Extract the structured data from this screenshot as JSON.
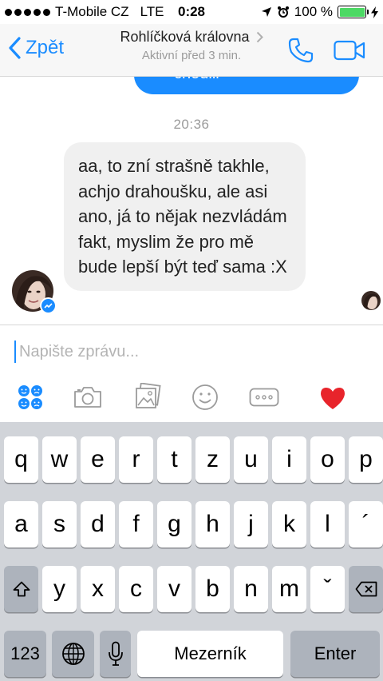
{
  "status_bar": {
    "carrier": "T-Mobile CZ",
    "network": "LTE",
    "time": "0:28",
    "battery": "100 %"
  },
  "header": {
    "back_label": "Zpět",
    "contact_name": "Rohlíčková královna",
    "status": "Aktivní před 3 min."
  },
  "chat": {
    "previous_message_fragment": "chodili",
    "timestamp": "20:36",
    "message": "aa, to zní strašně takhle, achjo drahoušku, ale asi ano, já to nějak nezvládám fakt, myslim že pro mě bude lepší být teď sama :X"
  },
  "composer": {
    "placeholder": "Napište zprávu..."
  },
  "keyboard": {
    "row1": [
      "q",
      "w",
      "e",
      "r",
      "t",
      "z",
      "u",
      "i",
      "o",
      "p"
    ],
    "row2": [
      "a",
      "s",
      "d",
      "f",
      "g",
      "h",
      "j",
      "k",
      "l",
      "´"
    ],
    "row3": [
      "y",
      "x",
      "c",
      "v",
      "b",
      "n",
      "m",
      "ˇ"
    ],
    "numbers_label": "123",
    "space_label": "Mezerník",
    "enter_label": "Enter"
  },
  "colors": {
    "accent": "#1a8cff",
    "bubble": "#f0f0f0",
    "keyboard_bg": "#d1d4d9",
    "heart": "#e8242b"
  }
}
